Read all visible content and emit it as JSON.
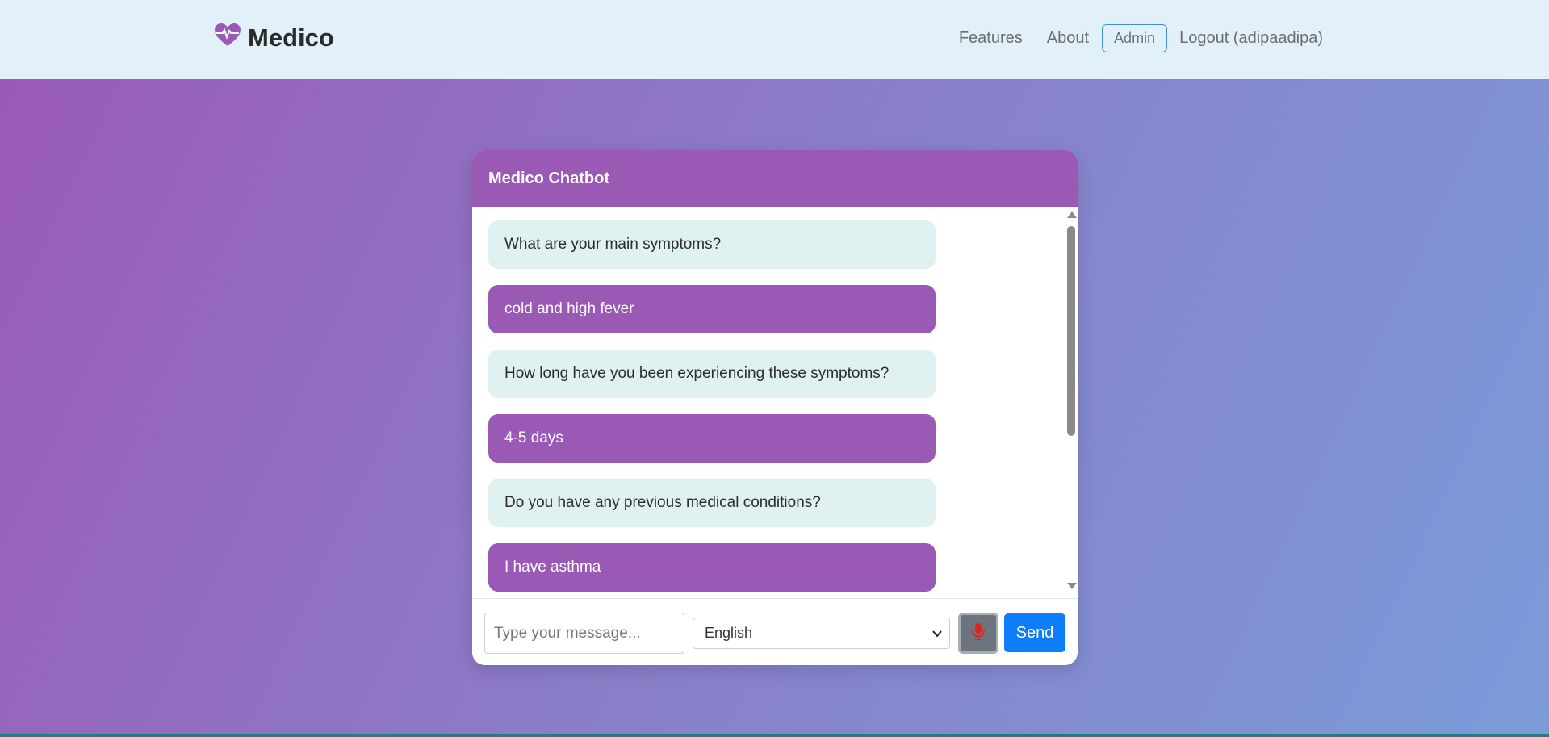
{
  "navbar": {
    "brand": "Medico",
    "links": [
      "Features",
      "About"
    ],
    "admin_label": "Admin",
    "logout_label": "Logout (adipaadipa)"
  },
  "chat": {
    "title": "Medico Chatbot",
    "messages": [
      {
        "role": "bot",
        "text": "What are your main symptoms?"
      },
      {
        "role": "user",
        "text": "cold and high fever"
      },
      {
        "role": "bot",
        "text": "How long have you been experiencing these symptoms?"
      },
      {
        "role": "user",
        "text": "4-5 days"
      },
      {
        "role": "bot",
        "text": "Do you have any previous medical conditions?"
      },
      {
        "role": "user",
        "text": "I have asthma"
      }
    ],
    "input_placeholder": "Type your message...",
    "language_selected": "English",
    "send_label": "Send",
    "mic_icon": "microphone-icon"
  },
  "colors": {
    "brand_purple": "#9b59b6",
    "bot_bubble": "#dff1f0",
    "send_blue": "#0d7dfa",
    "navbar_bg": "#e1f0f9",
    "mic_red": "#e02424"
  }
}
